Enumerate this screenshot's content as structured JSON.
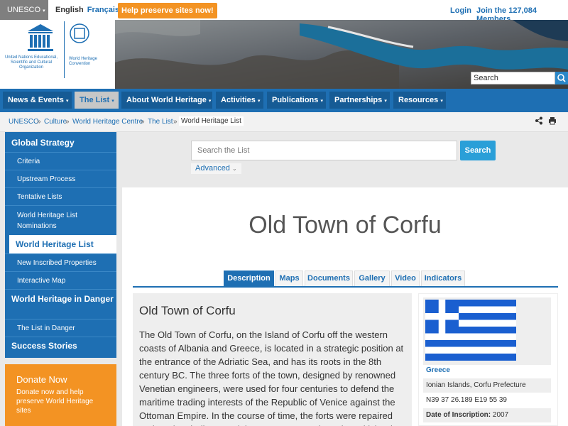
{
  "topbar": {
    "unesco_label": "UNESCO",
    "lang_en": "English",
    "lang_fr": "Français",
    "help_label": "Help preserve sites now!",
    "login_label": "Login",
    "join_label": "Join the 127,084 Members"
  },
  "header": {
    "unesco_logo_text": "United Nations Educational, Scientific and Cultural Organization",
    "whc_logo_text": "World Heritage Convention",
    "search_placeholder": "Search"
  },
  "nav": {
    "items": [
      {
        "label": "News & Events"
      },
      {
        "label": "The List"
      },
      {
        "label": "About World Heritage"
      },
      {
        "label": "Activities"
      },
      {
        "label": "Publications"
      },
      {
        "label": "Partnerships"
      },
      {
        "label": "Resources"
      }
    ]
  },
  "breadcrumb": {
    "items": [
      "UNESCO",
      "Culture",
      "World Heritage Centre",
      "The List",
      "World Heritage List"
    ]
  },
  "sidebar": {
    "items": [
      {
        "label": "Global Strategy"
      },
      {
        "label": "Criteria"
      },
      {
        "label": "Upstream Process"
      },
      {
        "label": "Tentative Lists"
      },
      {
        "label": "World Heritage List Nominations"
      },
      {
        "label": "World Heritage List"
      },
      {
        "label": "New Inscribed Properties"
      },
      {
        "label": "Interactive Map"
      },
      {
        "label": "World Heritage in Danger"
      },
      {
        "label": "The List in Danger"
      },
      {
        "label": "Success Stories"
      }
    ]
  },
  "donate": {
    "title": "Donate Now",
    "desc": "Donate now and help preserve World Heritage sites"
  },
  "search": {
    "placeholder": "Search the List",
    "button": "Search",
    "advanced": "Advanced"
  },
  "page": {
    "title": "Old Town of Corfu",
    "tabs": [
      "Description",
      "Maps",
      "Documents",
      "Gallery",
      "Video",
      "Indicators"
    ],
    "desc_title": "Old Town of Corfu",
    "desc_text": "The Old Town of Corfu, on the Island of Corfu off the western coasts of Albania and Greece, is located in a strategic position at the entrance of the Adriatic Sea, and has its roots in the 8th century BC. The three forts of the town, designed by renowned Venetian engineers, were used for four centuries to defend the maritime trading interests of the Republic of Venice against the Ottoman Empire. In the course of time, the forts were repaired and partly rebuilt several times, more recently under British rule"
  },
  "info": {
    "country": "Greece",
    "region": "Ionian Islands, Corfu Prefecture",
    "coords": "N39 37 26.189 E19 55 39",
    "inscription_label": "Date of Inscription:",
    "inscription_value": "2007"
  },
  "colors": {
    "brand_blue": "#1e6fb3",
    "accent_orange": "#f39323",
    "search_blue": "#2a9fd8",
    "flag_blue": "#1a5fd0"
  }
}
